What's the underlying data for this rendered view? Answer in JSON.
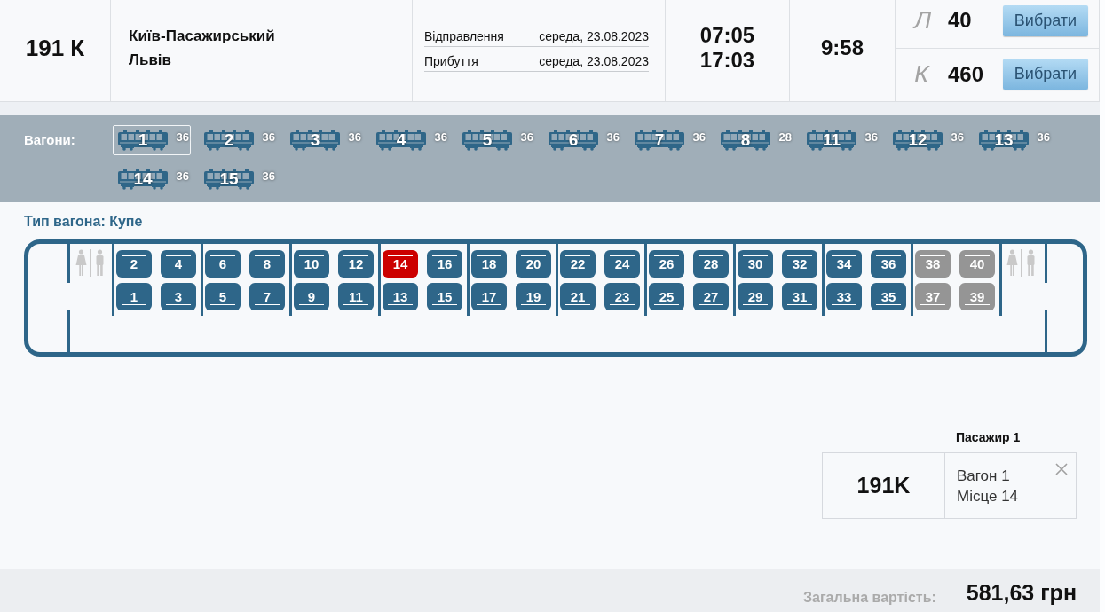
{
  "train": {
    "number": "191 К",
    "route": [
      "Київ-Пасажирський",
      "Львів"
    ],
    "schedule": [
      {
        "label": "Відправлення",
        "date": "середа, 23.08.2023"
      },
      {
        "label": "Прибуття",
        "date": "середа, 23.08.2023"
      }
    ],
    "times": [
      "07:05",
      "17:03"
    ],
    "duration": "9:58",
    "classes": [
      {
        "code": "Л",
        "seats": "40",
        "action": "Вибрати"
      },
      {
        "code": "К",
        "seats": "460",
        "action": "Вибрати"
      }
    ]
  },
  "wagons": {
    "label": "Вагони:",
    "items": [
      {
        "number": "1",
        "free": "36",
        "selected": true
      },
      {
        "number": "2",
        "free": "36",
        "selected": false
      },
      {
        "number": "3",
        "free": "36",
        "selected": false
      },
      {
        "number": "4",
        "free": "36",
        "selected": false
      },
      {
        "number": "5",
        "free": "36",
        "selected": false
      },
      {
        "number": "6",
        "free": "36",
        "selected": false
      },
      {
        "number": "7",
        "free": "36",
        "selected": false
      },
      {
        "number": "8",
        "free": "28",
        "selected": false
      },
      {
        "number": "11",
        "free": "36",
        "selected": false
      },
      {
        "number": "12",
        "free": "36",
        "selected": false
      },
      {
        "number": "13",
        "free": "36",
        "selected": false
      },
      {
        "number": "14",
        "free": "36",
        "selected": false
      },
      {
        "number": "15",
        "free": "36",
        "selected": false
      }
    ]
  },
  "coach": {
    "type": "Тип вагона: Купе",
    "compartments": [
      {
        "seats": [
          {
            "number": "2",
            "kind": "upper",
            "selected": false,
            "available": true
          },
          {
            "number": "4",
            "kind": "upper",
            "selected": false,
            "available": true
          },
          {
            "number": "1",
            "kind": "lower",
            "selected": false,
            "available": true
          },
          {
            "number": "3",
            "kind": "lower",
            "selected": false,
            "available": true
          }
        ]
      },
      {
        "seats": [
          {
            "number": "6",
            "kind": "upper",
            "selected": false,
            "available": true
          },
          {
            "number": "8",
            "kind": "upper",
            "selected": false,
            "available": true
          },
          {
            "number": "5",
            "kind": "lower",
            "selected": false,
            "available": true
          },
          {
            "number": "7",
            "kind": "lower",
            "selected": false,
            "available": true
          }
        ]
      },
      {
        "seats": [
          {
            "number": "10",
            "kind": "upper",
            "selected": false,
            "available": true
          },
          {
            "number": "12",
            "kind": "upper",
            "selected": false,
            "available": true
          },
          {
            "number": "9",
            "kind": "lower",
            "selected": false,
            "available": true
          },
          {
            "number": "11",
            "kind": "lower",
            "selected": false,
            "available": true
          }
        ]
      },
      {
        "seats": [
          {
            "number": "14",
            "kind": "upper",
            "selected": true,
            "available": true
          },
          {
            "number": "16",
            "kind": "upper",
            "selected": false,
            "available": true
          },
          {
            "number": "13",
            "kind": "lower",
            "selected": false,
            "available": true
          },
          {
            "number": "15",
            "kind": "lower",
            "selected": false,
            "available": true
          }
        ]
      },
      {
        "seats": [
          {
            "number": "18",
            "kind": "upper",
            "selected": false,
            "available": true
          },
          {
            "number": "20",
            "kind": "upper",
            "selected": false,
            "available": true
          },
          {
            "number": "17",
            "kind": "lower",
            "selected": false,
            "available": true
          },
          {
            "number": "19",
            "kind": "lower",
            "selected": false,
            "available": true
          }
        ]
      },
      {
        "seats": [
          {
            "number": "22",
            "kind": "upper",
            "selected": false,
            "available": true
          },
          {
            "number": "24",
            "kind": "upper",
            "selected": false,
            "available": true
          },
          {
            "number": "21",
            "kind": "lower",
            "selected": false,
            "available": true
          },
          {
            "number": "23",
            "kind": "lower",
            "selected": false,
            "available": true
          }
        ]
      },
      {
        "seats": [
          {
            "number": "26",
            "kind": "upper",
            "selected": false,
            "available": true
          },
          {
            "number": "28",
            "kind": "upper",
            "selected": false,
            "available": true
          },
          {
            "number": "25",
            "kind": "lower",
            "selected": false,
            "available": true
          },
          {
            "number": "27",
            "kind": "lower",
            "selected": false,
            "available": true
          }
        ]
      },
      {
        "seats": [
          {
            "number": "30",
            "kind": "upper",
            "selected": false,
            "available": true
          },
          {
            "number": "32",
            "kind": "upper",
            "selected": false,
            "available": true
          },
          {
            "number": "29",
            "kind": "lower",
            "selected": false,
            "available": true
          },
          {
            "number": "31",
            "kind": "lower",
            "selected": false,
            "available": true
          }
        ]
      },
      {
        "seats": [
          {
            "number": "34",
            "kind": "upper",
            "selected": false,
            "available": true
          },
          {
            "number": "36",
            "kind": "upper",
            "selected": false,
            "available": true
          },
          {
            "number": "33",
            "kind": "lower",
            "selected": false,
            "available": true
          },
          {
            "number": "35",
            "kind": "lower",
            "selected": false,
            "available": true
          }
        ]
      },
      {
        "seats": [
          {
            "number": "38",
            "kind": "upper",
            "selected": false,
            "available": false
          },
          {
            "number": "40",
            "kind": "upper",
            "selected": false,
            "available": false
          },
          {
            "number": "37",
            "kind": "lower",
            "selected": false,
            "available": false
          },
          {
            "number": "39",
            "kind": "lower",
            "selected": false,
            "available": false
          }
        ]
      }
    ]
  },
  "passenger": {
    "title": "Пасажир 1",
    "train": "191K",
    "wagon": "Вагон 1",
    "seat": "Місце 14"
  },
  "total": {
    "label": "Загальна вартість:",
    "value": "581,63 грн"
  }
}
